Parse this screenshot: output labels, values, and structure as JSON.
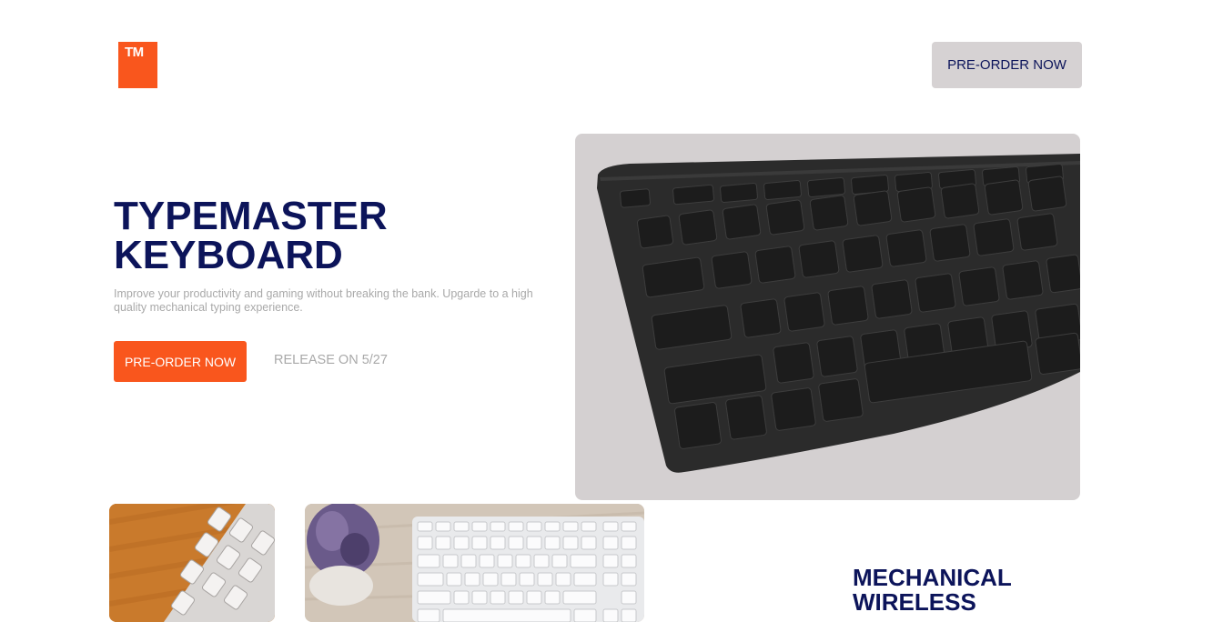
{
  "header": {
    "logo_text": "TM",
    "cta_label": "PRE-ORDER NOW"
  },
  "hero": {
    "title_line1": "TYPEMASTER",
    "title_line2": "KEYBOARD",
    "description": "Improve your productivity and gaming without breaking the bank. Upgarde to a high quality mechanical typing experience.",
    "cta_label": "PRE-ORDER NOW",
    "release_text": "RELEASE ON 5/27"
  },
  "features": {
    "title_line1": "MECHANICAL",
    "title_line2": "WIRELESS"
  },
  "colors": {
    "accent": "#f9561d",
    "navy": "#0c145a",
    "muted_text": "#a9a9a9",
    "button_gray": "#d6d2d3",
    "image_bg": "#d4d0d1"
  }
}
